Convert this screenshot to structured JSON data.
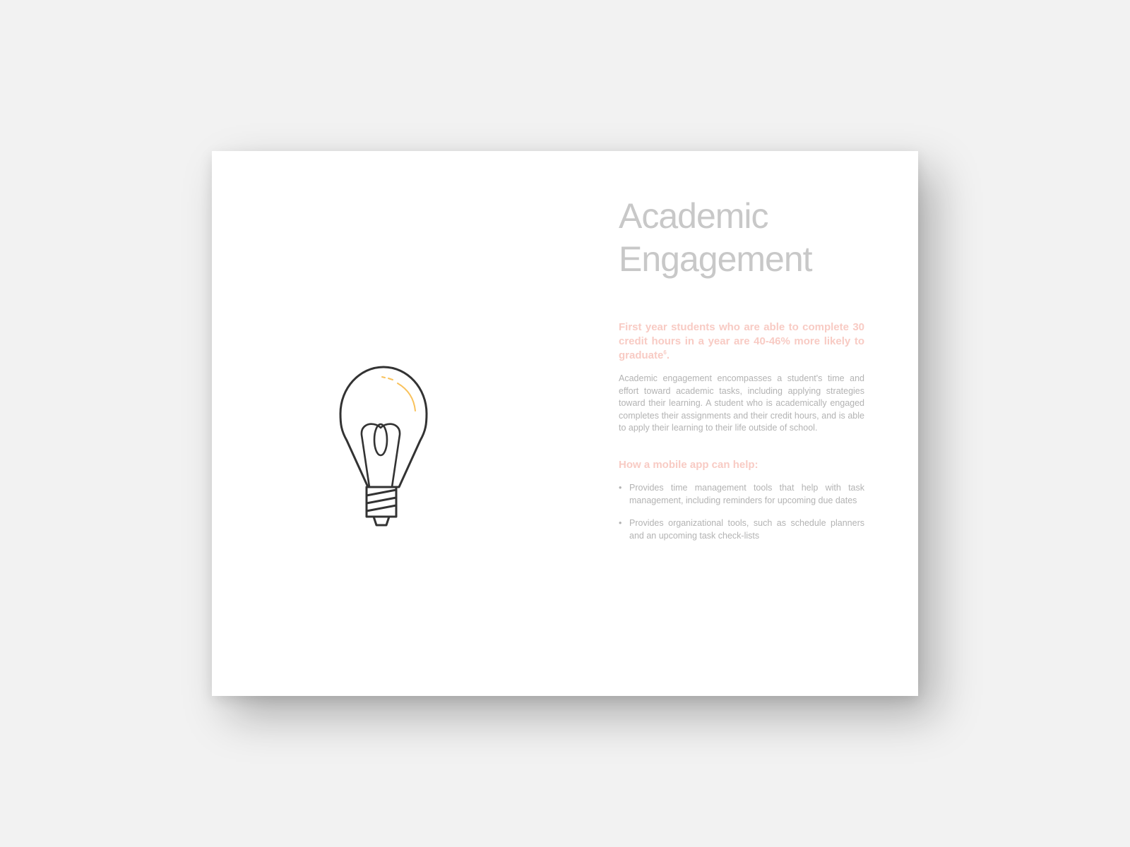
{
  "page": {
    "title_line1": "Academic",
    "title_line2": "Engagement",
    "lead_text": "First year students who are able to complete 30 credit hours in a year are 40-46% more likely to graduate",
    "lead_footnote": "6",
    "lead_end": ".",
    "body_text": "Academic engagement encompasses a student's time and effort toward academic tasks, including applying strategies toward their learning. A student who is academically engaged completes their assignments and their credit hours, and is able to apply their learning to their life outside of school.",
    "subhead": "How a mobile app can help:",
    "bullet_marker": "•",
    "bullets": [
      "Provides time management tools that help with task management, including reminders for upcoming due dates",
      "Provides organizational tools, such as schedule planners and an upcoming task check-lists"
    ]
  },
  "illustration": {
    "icon": "lightbulb-icon",
    "outline_color": "#333333",
    "highlight_color": "#f9c25c"
  },
  "colors": {
    "background": "#f2f2f2",
    "page": "#ffffff",
    "title": "#c8c8c8",
    "accent": "#f8cbc4",
    "body": "#b3b3b3"
  }
}
